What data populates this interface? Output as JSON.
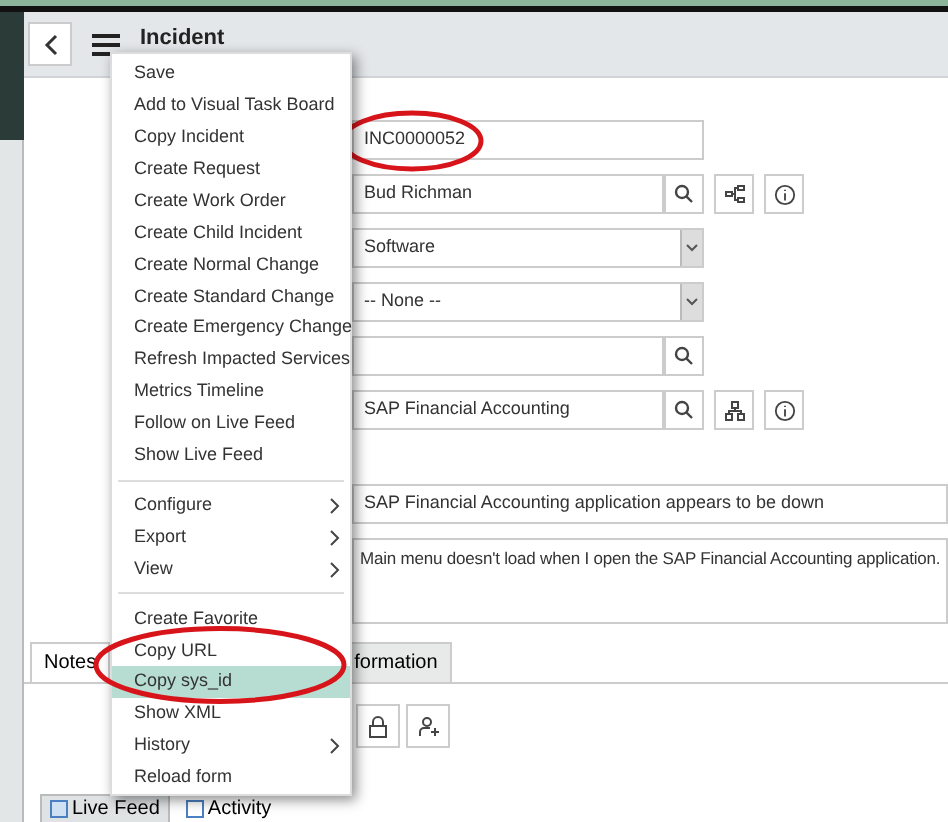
{
  "header": {
    "title": "Incident"
  },
  "menu": {
    "items": [
      {
        "label": "Save",
        "kind": "action",
        "selected": false
      },
      {
        "label": "Add to Visual Task Board",
        "kind": "action",
        "selected": false
      },
      {
        "label": "Copy Incident",
        "kind": "action",
        "selected": false
      },
      {
        "label": "Create Request",
        "kind": "action",
        "selected": false
      },
      {
        "label": "Create Work Order",
        "kind": "action",
        "selected": false
      },
      {
        "label": "Create Child Incident",
        "kind": "action",
        "selected": false
      },
      {
        "label": "Create Normal Change",
        "kind": "action",
        "selected": false
      },
      {
        "label": "Create Standard Change",
        "kind": "action",
        "selected": false
      },
      {
        "label": "Create Emergency Change",
        "kind": "action",
        "selected": false
      },
      {
        "label": "Refresh Impacted Services",
        "kind": "action",
        "selected": false
      },
      {
        "label": "Metrics Timeline",
        "kind": "action",
        "selected": false
      },
      {
        "label": "Follow on Live Feed",
        "kind": "action",
        "selected": false
      },
      {
        "label": "Show Live Feed",
        "kind": "action",
        "selected": false
      },
      {
        "kind": "divider"
      },
      {
        "label": "Configure",
        "kind": "submenu",
        "selected": false
      },
      {
        "label": "Export",
        "kind": "submenu",
        "selected": false
      },
      {
        "label": "View",
        "kind": "submenu",
        "selected": false
      },
      {
        "kind": "divider"
      },
      {
        "label": "Create Favorite",
        "kind": "action",
        "selected": false
      },
      {
        "label": "Copy URL",
        "kind": "action",
        "selected": false
      },
      {
        "label": "Copy sys_id",
        "kind": "action",
        "selected": true
      },
      {
        "label": "Show XML",
        "kind": "action",
        "selected": false
      },
      {
        "label": "History",
        "kind": "submenu",
        "selected": false
      },
      {
        "label": "Reload form",
        "kind": "action",
        "selected": false
      }
    ]
  },
  "fields": [
    {
      "kind": "text",
      "value": "INC0000052",
      "circled": true
    },
    {
      "kind": "reference_tree",
      "value": "Bud Richman"
    },
    {
      "kind": "select",
      "value": "Software"
    },
    {
      "kind": "select",
      "value": "-- None --"
    },
    {
      "kind": "reference"
    },
    {
      "kind": "reference_org",
      "value": "SAP Financial Accounting"
    },
    {
      "kind": "gap"
    },
    {
      "kind": "wide",
      "value": "SAP Financial Accounting application appears to be down"
    },
    {
      "kind": "textarea",
      "value": "Main menu doesn't load when I open the SAP Financial Accounting application."
    }
  ],
  "tabs": [
    {
      "label": "Notes",
      "selected": true
    },
    {
      "label": "formation",
      "selected": false
    }
  ],
  "feed_tabs": [
    {
      "label": "Live Feed",
      "selected": true
    },
    {
      "label": "Activity",
      "selected": false
    }
  ]
}
